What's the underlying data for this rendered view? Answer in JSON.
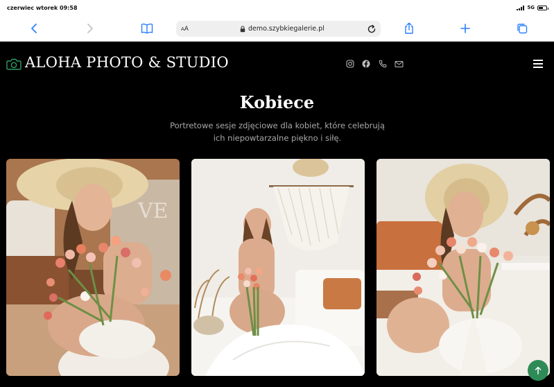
{
  "status_bar": {
    "time": "czerwiec wtorek 09:58",
    "network": "5G"
  },
  "browser": {
    "text_size_label_small": "A",
    "text_size_label_large": "A",
    "url": "demo.szybkiegalerie.pl"
  },
  "site": {
    "logo_text": "ALOHA PHOTO & STUDIO",
    "social_icons": [
      "instagram-icon",
      "facebook-icon",
      "phone-icon",
      "email-icon"
    ],
    "accent_color": "#2e8b57"
  },
  "section": {
    "title": "Kobiece",
    "subtitle": "Portretowe sesje zdjęciowe dla kobiet, które celebrują ich niepowtarzalne piękno i siłę."
  },
  "gallery": {
    "photos": [
      {
        "subject": "woman in straw hat holding tulips"
      },
      {
        "subject": "woman sitting on bed holding tulips"
      },
      {
        "subject": "woman in straw hat smiling with tulips"
      }
    ]
  }
}
